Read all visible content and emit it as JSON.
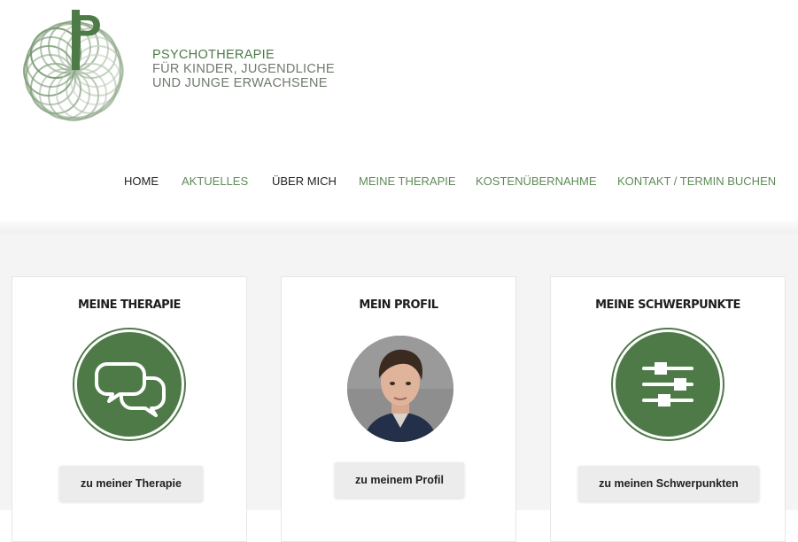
{
  "brand": {
    "logo_letter": "P",
    "tagline_lines": [
      "PSYCHOTHERAPIE",
      "FÜR KINDER, JUGENDLICHE",
      "UND JUNGE ERWACHSENE"
    ]
  },
  "nav": {
    "items": [
      {
        "label": "HOME"
      },
      {
        "label": "AKTUELLES"
      },
      {
        "label": "ÜBER MICH"
      },
      {
        "label": "MEINE THERAPIE"
      },
      {
        "label": "KOSTENÜBERNAHME"
      },
      {
        "label": "KONTAKT / TERMIN BUCHEN"
      }
    ]
  },
  "cards": [
    {
      "title": "MEINE THERAPIE",
      "icon": "speech-bubbles-icon",
      "button": "zu meiner Therapie"
    },
    {
      "title": "MEIN PROFIL",
      "icon": "profile-photo",
      "button": "zu meinem Profil"
    },
    {
      "title": "MEINE SCHWERPUNKTE",
      "icon": "sliders-icon",
      "button": "zu meinen Schwerpunkten"
    }
  ],
  "colors": {
    "accent": "#4e7a48",
    "nav_link": "#5e8b57",
    "nav_dark": "#222222",
    "section_bg": "#f4f4f4"
  }
}
